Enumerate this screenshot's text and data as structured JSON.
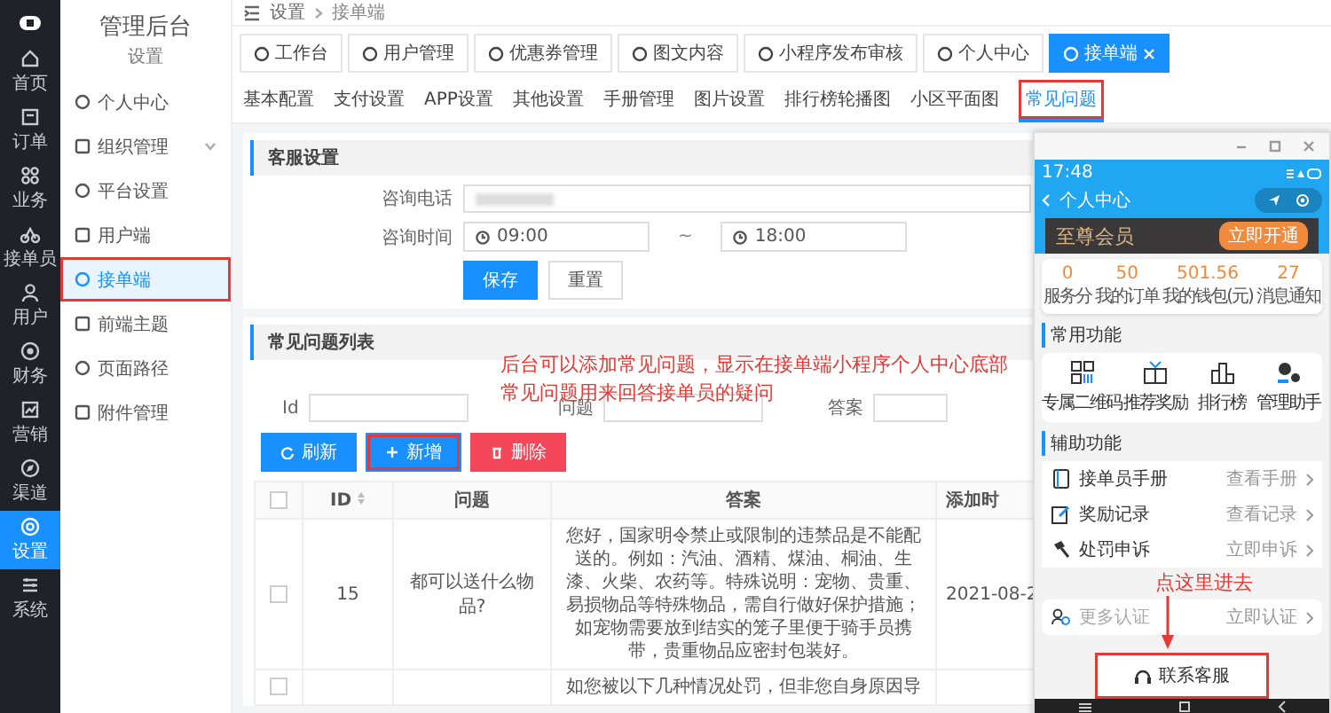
{
  "rail": {
    "items": [
      {
        "label": "首页",
        "selected": false
      },
      {
        "label": "订单",
        "selected": false
      },
      {
        "label": "业务",
        "selected": false
      },
      {
        "label": "接单员",
        "selected": false
      },
      {
        "label": "用户",
        "selected": false
      },
      {
        "label": "财务",
        "selected": false
      },
      {
        "label": "营销",
        "selected": false
      },
      {
        "label": "渠道",
        "selected": false
      },
      {
        "label": "设置",
        "selected": true
      },
      {
        "label": "系统",
        "selected": false
      }
    ]
  },
  "submenu": {
    "title": "管理后台",
    "subtitle": "设置",
    "items": [
      {
        "label": "个人中心",
        "selected": false,
        "highlighted": false,
        "kind": "link"
      },
      {
        "label": "组织管理",
        "selected": false,
        "highlighted": false,
        "kind": "group"
      },
      {
        "label": "平台设置",
        "selected": false,
        "highlighted": false,
        "kind": "link"
      },
      {
        "label": "用户端",
        "selected": false,
        "highlighted": false,
        "kind": "link"
      },
      {
        "label": "接单端",
        "selected": true,
        "highlighted": true,
        "kind": "link"
      },
      {
        "label": "前端主题",
        "selected": false,
        "highlighted": false,
        "kind": "link"
      },
      {
        "label": "页面路径",
        "selected": false,
        "highlighted": false,
        "kind": "link"
      },
      {
        "label": "附件管理",
        "selected": false,
        "highlighted": false,
        "kind": "link"
      }
    ]
  },
  "breadcrumb": [
    "设置",
    "接单端"
  ],
  "page_tabs": [
    {
      "label": "工作台",
      "selected": false
    },
    {
      "label": "用户管理",
      "selected": false
    },
    {
      "label": "优惠券管理",
      "selected": false
    },
    {
      "label": "图文内容",
      "selected": false
    },
    {
      "label": "小程序发布审核",
      "selected": false
    },
    {
      "label": "个人中心",
      "selected": false
    },
    {
      "label": "接单端",
      "selected": true
    }
  ],
  "settings_tabs": [
    {
      "label": "基本配置",
      "selected": false,
      "highlighted": false
    },
    {
      "label": "支付设置",
      "selected": false,
      "highlighted": false
    },
    {
      "label": "APP设置",
      "selected": false,
      "highlighted": false
    },
    {
      "label": "其他设置",
      "selected": false,
      "highlighted": false
    },
    {
      "label": "手册管理",
      "selected": false,
      "highlighted": false
    },
    {
      "label": "图片设置",
      "selected": false,
      "highlighted": false
    },
    {
      "label": "排行榜轮播图",
      "selected": false,
      "highlighted": false
    },
    {
      "label": "小区平面图",
      "selected": false,
      "highlighted": false
    },
    {
      "label": "常见问题",
      "selected": true,
      "highlighted": true
    }
  ],
  "service_settings": {
    "title": "客服设置",
    "phone_label": "咨询电话",
    "hours_label": "咨询时间",
    "start": "09:00",
    "separator": "~",
    "end": "18:00",
    "buttons": [
      {
        "label": "保存",
        "kind": "primary"
      },
      {
        "label": "重置",
        "kind": "default"
      }
    ]
  },
  "faq": {
    "title": "常见问题列表",
    "filters": [
      {
        "label": "Id"
      },
      {
        "label": "问题"
      },
      {
        "label": "答案"
      }
    ],
    "actions": [
      {
        "label": "刷新",
        "kind": "refresh",
        "highlighted": false
      },
      {
        "label": "新增",
        "kind": "add",
        "highlighted": true
      },
      {
        "label": "删除",
        "kind": "delete",
        "highlighted": false
      }
    ],
    "table": {
      "all_checked": false,
      "columns": [
        "ID",
        "问题",
        "答案",
        "添加时"
      ],
      "rows": [
        {
          "checked": false,
          "cells": [
            "15",
            "都可以送什么物品?",
            "您好，国家明令禁止或限制的违禁品是不能配送的。例如：汽油、酒精、煤油、桐油、生漆、火柴、农药等。特殊说明：宠物、贵重、易损物品等特殊物品，需自行做好保护措施；如宠物需要放到结实的笼子里便于骑手员携带，贵重物品应密封包装好。",
            "2021-08-2"
          ]
        },
        {
          "checked": false,
          "cells": [
            "",
            "",
            "如您被以下几种情况处罚，但非您自身原因导",
            ""
          ]
        }
      ]
    }
  },
  "phone_preview": {
    "status_time": "17:48",
    "title": "个人中心",
    "member": {
      "label": "至尊会员",
      "button": "立即开通"
    },
    "stats": [
      {
        "value": "0",
        "label": "服务分"
      },
      {
        "value": "50",
        "label": "我的订单"
      },
      {
        "value": "501.56",
        "label": "我的钱包(元)"
      },
      {
        "value": "27",
        "label": "消息通知"
      }
    ],
    "common": {
      "title": "常用功能",
      "items": [
        {
          "label": "专属二维码"
        },
        {
          "label": "推荐奖励"
        },
        {
          "label": "排行榜"
        },
        {
          "label": "管理助手"
        }
      ]
    },
    "assist": {
      "title": "辅助功能",
      "items": [
        {
          "label": "接单员手册",
          "action": "查看手册"
        },
        {
          "label": "奖励记录",
          "action": "查看记录"
        },
        {
          "label": "处罚申诉",
          "action": "立即申诉"
        },
        {
          "label": "更多认证",
          "action": "立即认证"
        }
      ]
    },
    "contact": {
      "label": "联系客服",
      "highlighted": true
    }
  },
  "annotations": [
    {
      "kind": "note",
      "text": "后台可以添加常见问题，显示在接单端小程序个人中心底部"
    },
    {
      "kind": "note",
      "text": "常见问题用来回答接单员的疑问"
    },
    {
      "kind": "pointer",
      "text": "点这里进去"
    }
  ]
}
